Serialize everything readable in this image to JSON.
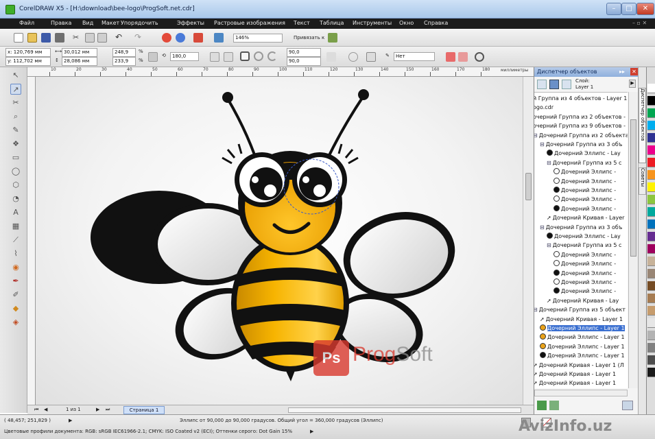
{
  "window": {
    "title": "CorelDRAW X5 - [H:\\download\\bee-logo\\ProgSoft.net.cdr]"
  },
  "menu": [
    "Файл",
    "Правка",
    "Вид",
    "Макет",
    "Упорядочить",
    "Эффекты",
    "Растровые изображения",
    "Текст",
    "Таблица",
    "Инструменты",
    "Окно",
    "Справка"
  ],
  "toolbar": {
    "zoom": "146%",
    "snap_label": "Привязать к"
  },
  "propbar": {
    "x": "x: 120,769 мм",
    "y": "y: 112,702 мм",
    "w": "30,012 мм",
    "h": "28,086 мм",
    "scale_w": "248,9",
    "scale_h": "233,9",
    "pct": "%",
    "angle": "180,0",
    "start_angle": "90,0",
    "end_angle": "90,0",
    "outline": "Нет"
  },
  "ruler": {
    "marks": [
      "10",
      "20",
      "30",
      "40",
      "50",
      "60",
      "70",
      "80",
      "90",
      "100",
      "110",
      "120",
      "130",
      "140",
      "150",
      "160",
      "170",
      "180"
    ],
    "unit": "миллиметры"
  },
  "pagebar": {
    "counter": "1 из 1",
    "page_tab": "Страница 1"
  },
  "docker": {
    "title": "Диспетчер объектов",
    "layer_label": "Слой:",
    "layer_name": "Layer 1",
    "side_tabs": [
      "Диспетчер объектов",
      "Советы"
    ],
    "tree": [
      {
        "text": "й Группа из 4 объектов - Layer 1",
        "icon": "none",
        "indent": 0
      },
      {
        "text": "ogo.cdr",
        "icon": "none",
        "indent": 0
      },
      {
        "text": "очерний Группа из 2 объектов -",
        "icon": "none",
        "indent": 0
      },
      {
        "text": "очерний Группа из 9 объектов -",
        "icon": "none",
        "indent": 0
      },
      {
        "text": "Дочерний Группа из 2 объекта",
        "icon": "group",
        "indent": 0
      },
      {
        "text": "Дочерний Группа из 3 объ",
        "icon": "group",
        "indent": 1
      },
      {
        "text": "Дочерний Эллипс - Lay",
        "icon": "black",
        "indent": 2
      },
      {
        "text": "Дочерний Группа из 5 с",
        "icon": "group",
        "indent": 2
      },
      {
        "text": "Дочерний Эллипс -",
        "icon": "white",
        "indent": 3
      },
      {
        "text": "Дочерний Эллипс -",
        "icon": "white",
        "indent": 3
      },
      {
        "text": "Дочерний Эллипс -",
        "icon": "black",
        "indent": 3
      },
      {
        "text": "Дочерний Эллипс -",
        "icon": "white",
        "indent": 3
      },
      {
        "text": "Дочерний Эллипс -",
        "icon": "black",
        "indent": 3
      },
      {
        "text": "Дочерний Кривая - Layer",
        "icon": "curve",
        "indent": 2
      },
      {
        "text": "Дочерний Группа из 3 объ",
        "icon": "group",
        "indent": 1
      },
      {
        "text": "Дочерний Эллипс - Lay",
        "icon": "black",
        "indent": 2
      },
      {
        "text": "Дочерний Группа из 5 с",
        "icon": "group",
        "indent": 2
      },
      {
        "text": "Дочерний Эллипс -",
        "icon": "white",
        "indent": 3
      },
      {
        "text": "Дочерний Эллипс -",
        "icon": "white",
        "indent": 3
      },
      {
        "text": "Дочерний Эллипс -",
        "icon": "black",
        "indent": 3
      },
      {
        "text": "Дочерний Эллипс -",
        "icon": "white",
        "indent": 3
      },
      {
        "text": "Дочерний Эллипс -",
        "icon": "black",
        "indent": 3
      },
      {
        "text": "Дочерний Кривая - Lay",
        "icon": "curve",
        "indent": 2
      },
      {
        "text": "Дочерний Группа из 5 объект",
        "icon": "group",
        "indent": 0
      },
      {
        "text": "Дочерний Кривая - Layer 1",
        "icon": "curve",
        "indent": 1
      },
      {
        "text": "Дочерний Эллипс - Layer 1",
        "icon": "orange",
        "indent": 1,
        "selected": true
      },
      {
        "text": "Дочерний Эллипс - Layer 1",
        "icon": "orange",
        "indent": 1
      },
      {
        "text": "Дочерний Эллипс - Layer 1",
        "icon": "orange",
        "indent": 1
      },
      {
        "text": "Дочерний Эллипс - Layer 1",
        "icon": "black",
        "indent": 1
      },
      {
        "text": "Дочерний Кривая - Layer 1 (Л",
        "icon": "curve",
        "indent": 0
      },
      {
        "text": "Дочерний Кривая - Layer 1",
        "icon": "curve",
        "indent": 0
      },
      {
        "text": "Дочерний Кривая - Layer 1",
        "icon": "curve",
        "indent": 0
      }
    ]
  },
  "palette": [
    "#ffffff",
    "#000000",
    "#00a651",
    "#00aeef",
    "#2e3192",
    "#ec008c",
    "#ed1c24",
    "#f7941d",
    "#fff200",
    "#8dc63f",
    "#00a99d",
    "#0072bc",
    "#662d91",
    "#9e005d",
    "#c7b299",
    "#998675",
    "#754c24",
    "#a67c52",
    "#c69c6d",
    "#e6e6e6",
    "#b3b3b3",
    "#808080",
    "#4d4d4d",
    "#1a1a1a"
  ],
  "status": {
    "coords": "( 48,457; 251,829 )",
    "info": "Эллипс от 90,000 до 90,000 градусов. Общий угол = 360,000 градусов (Эллипс)",
    "profiles": "Цветовые профили документа: RGB: sRGB IEC61966-2.1; CMYK: ISO Coated v2 (ECI); Оттенки серого: Dot Gain 15%"
  },
  "watermark": {
    "logo_badge": "Ps",
    "brand_a": "Prog",
    "brand_b": "Soft",
    "site": "AvizInfo.uz"
  }
}
